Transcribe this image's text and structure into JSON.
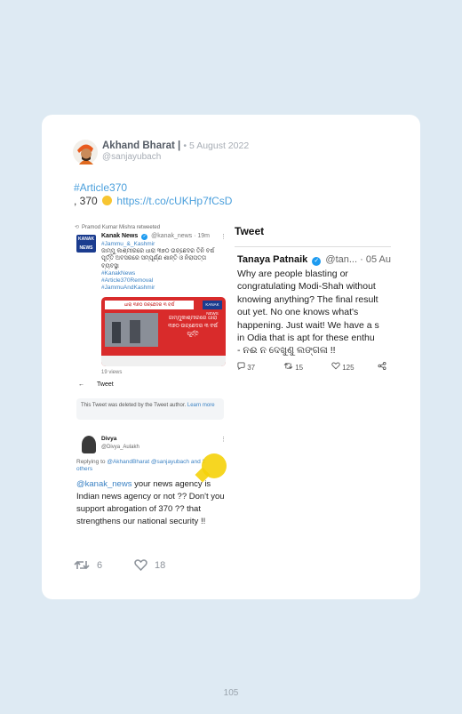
{
  "post": {
    "author_name": "Akhand Bharat",
    "separator": "|",
    "date": "• 5 August 2022",
    "handle": "@sanjayubach",
    "hashtag": "#Article370",
    "text_prefix": ", 370",
    "link": "https://t.co/cUKHp7fCsD",
    "retweets": "6",
    "likes": "18"
  },
  "left_shot": {
    "retweet_line": "Pramod Kumar Mishra retweeted",
    "logo_text": "KANAK NEWS",
    "kn_name": "Kanak News",
    "kn_meta": "@kanak_news · 19m",
    "kn_body_1": "#Jammu_&_Kashmir",
    "kn_body_2": "ଜାମ୍ମୁ କାଶ୍ମୀରରେ ଧାରା ୩୭୦ ଉଚ୍ଛେଦର ତିନି ବର୍ଷ ପୂର୍ତ୍ତି ଅବସରରେ ସମ୍ପୂର୍ଣ୍ଣ ଶାନ୍ତି ଓ ନିରାପତ୍ତା ବ୍ୟବସ୍ଥା",
    "kn_body_3": "#KanakNews",
    "kn_body_4": "#Article370Removal",
    "kn_body_5": "#JammuAndKashmir",
    "img_banner": "ଧାରା ୩୭୦ ଉଚ୍ଛେଦର ୩ ବର୍ଷ",
    "img_tag": "KANAK NEWS",
    "img_caption": "ଜାମ୍ମୁକାଶ୍ମୀରରେ ଧାରା ୩୭୦ ଉଚ୍ଛେଦର ୩ ବର୍ଷ ପୂର୍ତ୍ତି",
    "views": "19 views",
    "back_label": "Tweet",
    "deleted_text": "This Tweet was deleted by the Tweet author.",
    "deleted_link": "Learn more",
    "reply_name": "Divya",
    "reply_handle": "@Divya_Aulakh",
    "replying_prefix": "Replying to",
    "replying_users": "@AkhandBharat @sanjayubach and 2 others",
    "reply_mention": "@kanak_news",
    "reply_text": " your news agency is Indian news agency or not ?? Don't you support abrogation of 370 ?? that strengthens our national security !!"
  },
  "right_shot": {
    "header": "Tweet",
    "author": "Tanaya Patnaik",
    "handle": "@tan...",
    "date": "· 05 Au",
    "line1": "Why are people blasting or",
    "line2": "congratulating Modi-Shah without",
    "line3": "knowing anything? The final result",
    "line4": "out yet. No one knows what's",
    "line5": "happening. Just wait! We have a s",
    "line6": "in Odia that is apt for these enthu",
    "line7": "- ନଈ ନ ଦେଖୁଣୁ ଲଙ୍ଗଳା !!",
    "replies": "37",
    "retweets": "15",
    "likes": "125"
  },
  "page_number": "105",
  "colors": {
    "background": "#deeaf3",
    "link": "#4a9fdc",
    "muted": "#a7adb5",
    "verified": "#1d9bf0",
    "cursor_highlight": "#f5d20a"
  }
}
